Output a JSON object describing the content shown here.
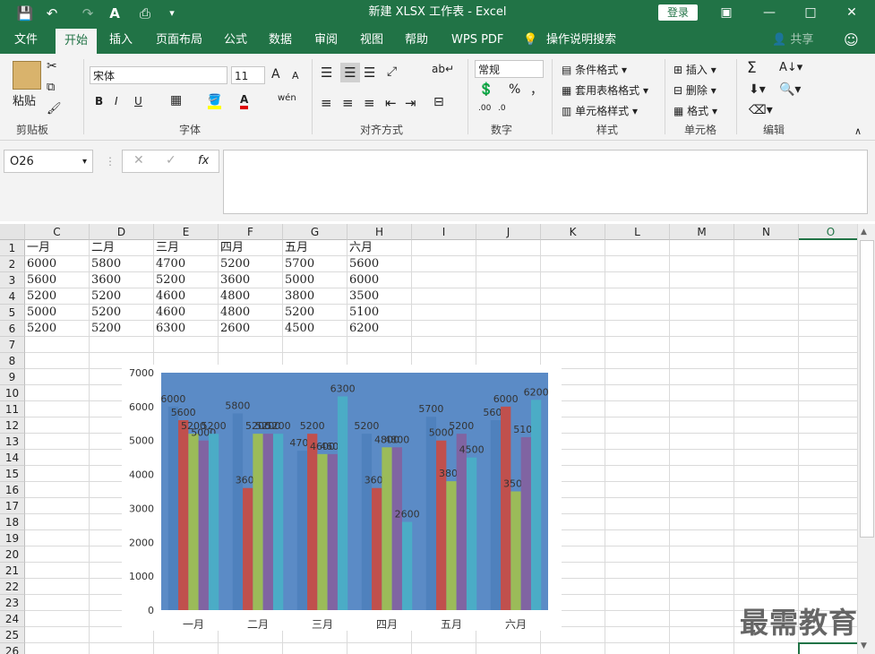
{
  "titlebar": {
    "title": "新建 XLSX 工作表  -  Excel",
    "login": "登录",
    "save_icon": "💾",
    "undo_icon": "↶",
    "redo_icon": "↷",
    "minimize": "—",
    "restore": "□",
    "close": "✕",
    "ribbon_display": "▣"
  },
  "tabs": [
    "文件",
    "开始",
    "插入",
    "页面布局",
    "公式",
    "数据",
    "审阅",
    "视图",
    "帮助",
    "WPS PDF",
    "操作说明搜索"
  ],
  "tabs_right": {
    "share": "共享"
  },
  "ribbon": {
    "clipboard": {
      "paste": "粘贴",
      "label": "剪贴板"
    },
    "font": {
      "name": "宋体",
      "size": "11",
      "label": "字体",
      "bold": "B",
      "italic": "I",
      "underline": "U",
      "grow": "A",
      "shrink": "A",
      "wen": "wén"
    },
    "alignment": {
      "label": "对齐方式"
    },
    "number": {
      "format": "常规",
      "percent": "%",
      "comma": "，",
      "label": "数字"
    },
    "styles": {
      "cond": "条件格式",
      "table": "套用表格格式",
      "cell": "单元格样式",
      "label": "样式"
    },
    "cells": {
      "insert": "插入",
      "delete": "删除",
      "format": "格式",
      "label": "单元格"
    },
    "edit": {
      "label": "编辑",
      "sigma": "Σ"
    }
  },
  "formula_bar": {
    "name_box": "O26",
    "fx": "fx",
    "formula": ""
  },
  "columns": [
    "C",
    "D",
    "E",
    "F",
    "G",
    "H",
    "I",
    "J",
    "K",
    "L",
    "M",
    "N",
    "O"
  ],
  "rows": [
    "1",
    "2",
    "3",
    "4",
    "5",
    "6",
    "7",
    "8",
    "9",
    "10",
    "11",
    "12",
    "13",
    "14",
    "15",
    "16",
    "17",
    "18",
    "19",
    "20",
    "21",
    "22",
    "23",
    "24",
    "25",
    "26"
  ],
  "cells": [
    [
      "一月",
      "二月",
      "三月",
      "四月",
      "五月",
      "六月"
    ],
    [
      "6000",
      "5800",
      "4700",
      "5200",
      "5700",
      "5600"
    ],
    [
      "5600",
      "3600",
      "5200",
      "3600",
      "5000",
      "6000"
    ],
    [
      "5200",
      "5200",
      "4600",
      "4800",
      "3800",
      "3500"
    ],
    [
      "5000",
      "5200",
      "4600",
      "4800",
      "5200",
      "5100"
    ],
    [
      "5200",
      "5200",
      "6300",
      "2600",
      "4500",
      "6200"
    ]
  ],
  "chart_data": {
    "type": "bar",
    "categories": [
      "一月",
      "二月",
      "三月",
      "四月",
      "五月",
      "六月"
    ],
    "series": [
      {
        "values": [
          6000,
          5800,
          4700,
          5200,
          5700,
          5600
        ]
      },
      {
        "values": [
          5600,
          3600,
          5200,
          3600,
          5000,
          6000
        ]
      },
      {
        "values": [
          5200,
          5200,
          4600,
          4800,
          3800,
          3500
        ]
      },
      {
        "values": [
          5000,
          5200,
          4600,
          4800,
          5200,
          5100
        ]
      },
      {
        "values": [
          5200,
          5200,
          6300,
          2600,
          4500,
          6200
        ]
      }
    ],
    "ylim": [
      0,
      7000
    ],
    "yticks": [
      "0",
      "1000",
      "2000",
      "3000",
      "4000",
      "5000",
      "6000",
      "7000"
    ],
    "colors": [
      "#4f81bd",
      "#c0504d",
      "#9bbb59",
      "#8064a2",
      "#4bacc6"
    ],
    "plot_bg": "#5b8bc6",
    "data_labels": true,
    "legend": "none",
    "grid": false
  },
  "watermark": "最需教育"
}
